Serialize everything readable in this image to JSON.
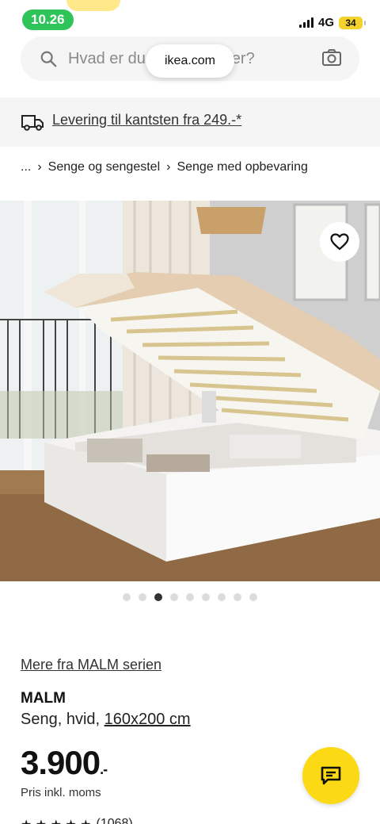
{
  "status_bar": {
    "time": "10.26",
    "network": "4G",
    "battery": "34"
  },
  "search": {
    "placeholder": "Hvad er du på udkig efter?"
  },
  "browser": {
    "url": "ikea.com"
  },
  "delivery": {
    "text": "Levering til kantsten fra 249.-*"
  },
  "breadcrumb": {
    "items": [
      "...",
      "Senge og sengestel",
      "Senge med opbevaring"
    ]
  },
  "gallery": {
    "image_count": 9,
    "active_index": 3
  },
  "product": {
    "series_link": "Mere fra MALM serien",
    "name": "MALM",
    "desc_prefix": "Seng, hvid, ",
    "size_link": "160x200 cm",
    "price": "3.900",
    "price_suffix": ".-",
    "price_note": "Pris inkl. moms",
    "rating_count": "(1068)"
  },
  "colors": {
    "accent_yellow": "#fbd914",
    "time_green": "#2fc45a",
    "banner_bg": "#f5f5f5"
  }
}
